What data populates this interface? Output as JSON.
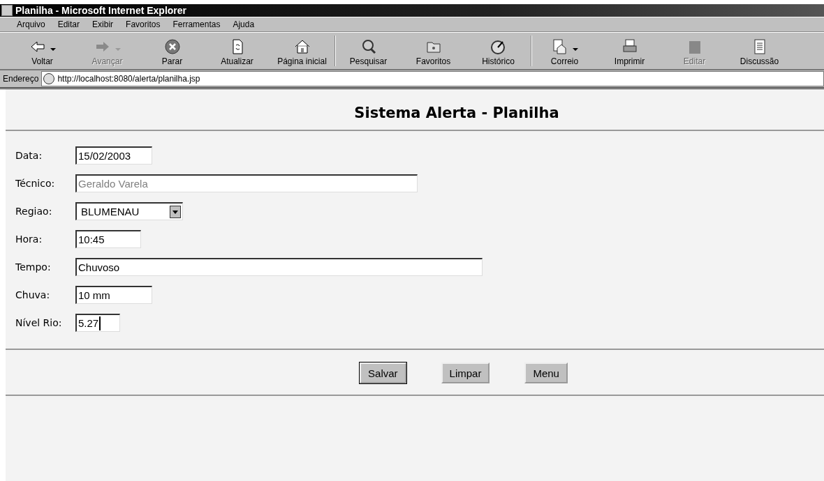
{
  "window": {
    "title": "Planilha - Microsoft Internet Explorer"
  },
  "menu": [
    "Arquivo",
    "Editar",
    "Exibir",
    "Favoritos",
    "Ferramentas",
    "Ajuda"
  ],
  "toolbar_groups": [
    [
      {
        "label": "Voltar",
        "disabled": false,
        "dropdown": true
      },
      {
        "label": "Avançar",
        "disabled": true,
        "dropdown": true
      },
      {
        "label": "Parar",
        "disabled": false,
        "dropdown": false
      },
      {
        "label": "Atualizar",
        "disabled": false,
        "dropdown": false
      },
      {
        "label": "Página inicial",
        "disabled": false,
        "dropdown": false
      }
    ],
    [
      {
        "label": "Pesquisar",
        "disabled": false,
        "dropdown": false
      },
      {
        "label": "Favoritos",
        "disabled": false,
        "dropdown": false
      },
      {
        "label": "Histórico",
        "disabled": false,
        "dropdown": false
      }
    ],
    [
      {
        "label": "Correio",
        "disabled": false,
        "dropdown": true
      },
      {
        "label": "Imprimir",
        "disabled": false,
        "dropdown": false
      },
      {
        "label": "Editar",
        "disabled": true,
        "dropdown": false
      },
      {
        "label": "Discussão",
        "disabled": false,
        "dropdown": false
      }
    ]
  ],
  "address_bar": {
    "label": "Endereço",
    "url": "http://localhost:8080/alerta/planilha.jsp"
  },
  "page": {
    "heading": "Sistema Alerta - Planilha",
    "fields": [
      {
        "kind": "text",
        "label": "Data:",
        "value": "15/02/2003",
        "focused": false
      },
      {
        "kind": "text",
        "label": "Técnico:",
        "placeholder": "Geraldo Varela",
        "focused": false
      },
      {
        "kind": "select",
        "label": "Regiao:",
        "value": "BLUMENAU"
      },
      {
        "kind": "text",
        "label": "Hora:",
        "value": "10:45",
        "focused": false
      },
      {
        "kind": "text",
        "label": "Tempo:",
        "value": "Chuvoso",
        "focused": false
      },
      {
        "kind": "text",
        "label": "Chuva:",
        "value": "10 mm",
        "focused": false
      },
      {
        "kind": "text",
        "label": "Nível Rio:",
        "value": "5.27",
        "focused": true
      }
    ],
    "buttons": [
      {
        "label": "Salvar",
        "focused": true
      },
      {
        "label": "Limpar",
        "focused": false
      },
      {
        "label": "Menu",
        "focused": false
      }
    ]
  }
}
